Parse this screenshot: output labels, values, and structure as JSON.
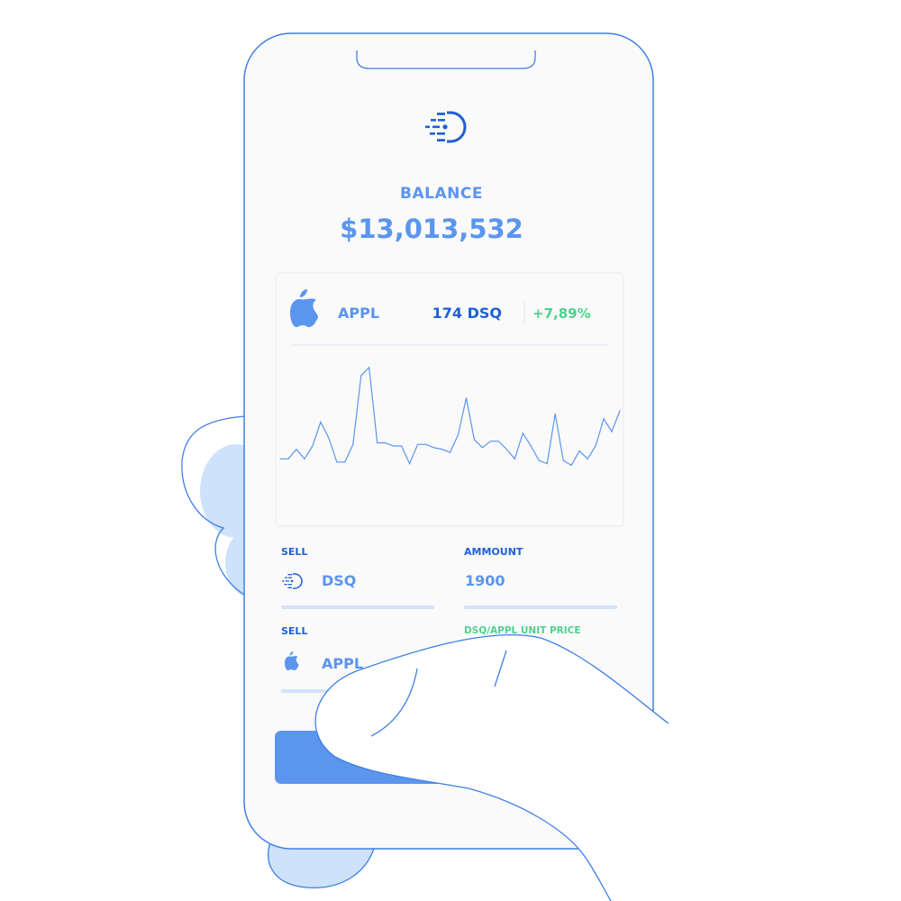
{
  "colors": {
    "primary": "#5b95ee",
    "dark_blue": "#1f5fd6",
    "outline": "#3f7fe6",
    "green": "#4fd18e",
    "light_blue": "#cfe2fb",
    "field_line": "#d2e3fa",
    "screen_bg": "#fafafa"
  },
  "balance": {
    "label": "BALANCE",
    "amount": "$13,013,532"
  },
  "stock": {
    "icon": "apple-icon",
    "name": "APPL",
    "quantity": "174 DSQ",
    "change": "+7,89%"
  },
  "chart_data": {
    "type": "line",
    "title": "",
    "xlabel": "",
    "ylabel": "",
    "ylim": [
      0,
      1
    ],
    "x": [
      0,
      1,
      2,
      3,
      4,
      5,
      6,
      7,
      8,
      9,
      10,
      11,
      12,
      13,
      14,
      15,
      16,
      17,
      18,
      19,
      20,
      21,
      22,
      23,
      24,
      25,
      26,
      27,
      28,
      29,
      30,
      31,
      32,
      33,
      34,
      35,
      36,
      37,
      38,
      39,
      40,
      41,
      42,
      43,
      44
    ],
    "series": [
      {
        "values": [
          0.33,
          0.33,
          0.39,
          0.33,
          0.41,
          0.56,
          0.46,
          0.31,
          0.31,
          0.42,
          0.85,
          0.9,
          0.43,
          0.43,
          0.41,
          0.41,
          0.3,
          0.42,
          0.42,
          0.4,
          0.39,
          0.37,
          0.48,
          0.71,
          0.45,
          0.4,
          0.44,
          0.44,
          0.39,
          0.33,
          0.49,
          0.41,
          0.32,
          0.3,
          0.61,
          0.32,
          0.29,
          0.38,
          0.33,
          0.41,
          0.58,
          0.5,
          0.63
        ]
      }
    ]
  },
  "trade": {
    "sell_label_1": "SELL",
    "sell_value_1": "DSQ",
    "sell_icon_1": "dsq-logo-icon",
    "amount_label": "AMMOUNT",
    "amount_value": "1900",
    "sell_label_2": "SELL",
    "sell_value_2": "APPL",
    "sell_icon_2": "apple-icon",
    "unit_price_label": "DSQ/APPL UNIT PRICE"
  },
  "icons": {
    "logo": "dsq-logo-icon"
  }
}
